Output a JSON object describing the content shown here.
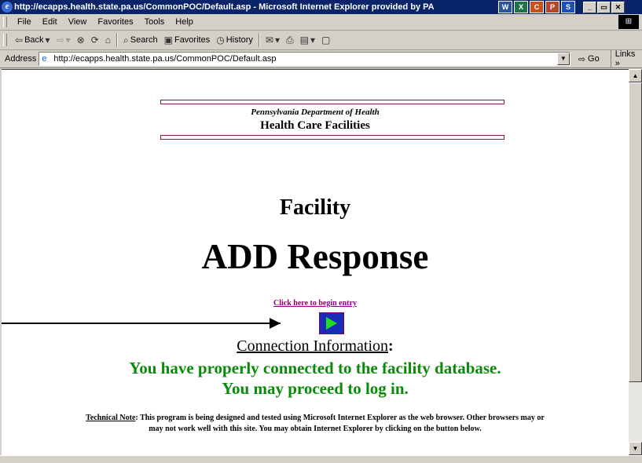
{
  "window": {
    "title": "http://ecapps.health.state.pa.us/CommonPOC/Default.asp - Microsoft Internet Explorer provided by PA",
    "taskbar_apps": [
      "W",
      "X",
      "C",
      "P",
      "S"
    ]
  },
  "menu": {
    "items": [
      "File",
      "Edit",
      "View",
      "Favorites",
      "Tools",
      "Help"
    ]
  },
  "toolbar": {
    "back": "Back",
    "search": "Search",
    "favorites": "Favorites",
    "history": "History"
  },
  "address": {
    "label": "Address",
    "url": "http://ecapps.health.state.pa.us/CommonPOC/Default.asp",
    "go": "Go",
    "links": "Links"
  },
  "page": {
    "header_subtitle": "Pennsylvania Department of Health",
    "header_title": "Health Care Facilities",
    "facility": "Facility",
    "add_response": "ADD Response",
    "entry_link": "Click here to begin entry",
    "connection_title": "Connection Information",
    "connection_colon": ":",
    "connection_line1": "You have properly connected to the facility database.",
    "connection_line2": "You may proceed to log in.",
    "tech_note_label": "Technical Note",
    "tech_note_text": ": This program is being designed and tested using Microsoft Internet Explorer as the web browser.  Other browsers may or may not work well with this site.  You may obtain Internet Explorer by clicking on the button below."
  },
  "colors": {
    "title_bar": "#0a246a",
    "header_rule": "#7a1f3d",
    "link_visited": "#800080",
    "success_text": "#0a8a0a",
    "go_button": "#1a2bb5",
    "go_arrow": "#22dd22"
  }
}
